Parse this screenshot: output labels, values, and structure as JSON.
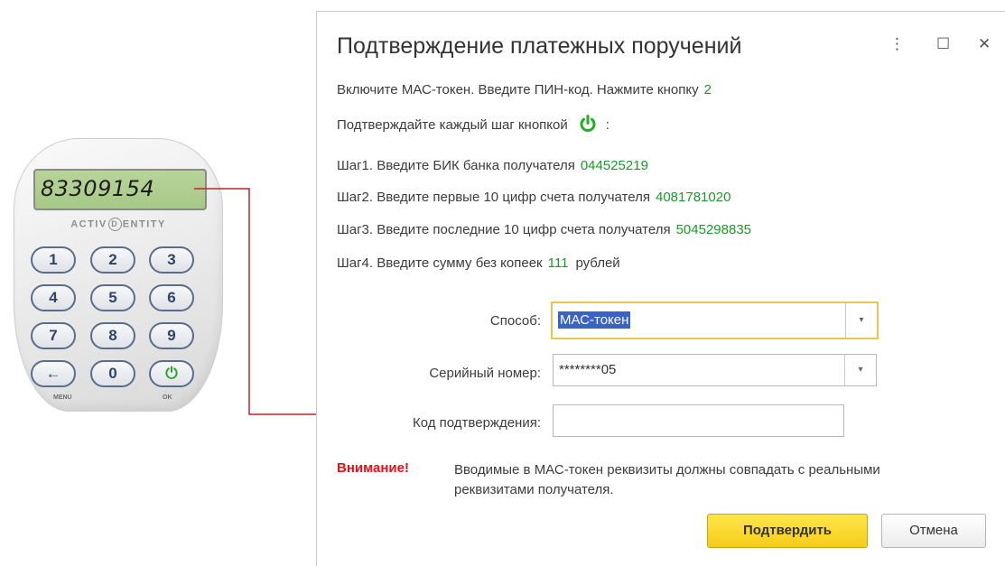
{
  "token": {
    "display": "83309154",
    "brand_left": "ACTIV",
    "brand_mid": "D",
    "brand_right": "ENTITY",
    "keys": [
      "1",
      "2",
      "3",
      "4",
      "5",
      "6",
      "7",
      "8",
      "9",
      "←",
      "0",
      "⏻"
    ],
    "menu_label": "MENU",
    "ok_label": "OK"
  },
  "dialog": {
    "title": "Подтверждение платежных поручений",
    "more_icon": "⋮",
    "maximize_icon": "☐",
    "close_icon": "✕",
    "instruction1": "Включите МАС-токен. Введите ПИН-код. Нажмите кнопку",
    "instruction1_value": "2",
    "instruction2": "Подтверждайте каждый шаг кнопкой",
    "instruction2_suffix": ":",
    "power_color": "#22b022",
    "steps": [
      {
        "label": "Шаг1. Введите БИК банка получателя",
        "value": "044525219",
        "suffix": ""
      },
      {
        "label": "Шаг2. Введите первые 10 цифр счета получателя",
        "value": "4081781020",
        "suffix": ""
      },
      {
        "label": "Шаг3. Введите последние 10 цифр счета получателя",
        "value": "5045298835",
        "suffix": ""
      },
      {
        "label": "Шаг4. Введите сумму без копеек",
        "value": "111",
        "suffix": "рублей"
      }
    ],
    "method_label": "Способ:",
    "method_value": "МАС-токен",
    "serial_label": "Серийный номер:",
    "serial_value": "********05",
    "code_label": "Код подтверждения:",
    "code_value": "",
    "warning_title": "Внимание!",
    "warning_text": "Вводимые в МАС-токен реквизиты должны совпадать с реальными реквизитами получателя.",
    "confirm_button": "Подтвердить",
    "cancel_button": "Отмена",
    "dropdown_icon": "▾"
  },
  "colors": {
    "value_green": "#1a9a2a",
    "warning_red": "#e0131b",
    "focus_yellow": "#f2c14f",
    "primary_yellow": "#f6cd16"
  }
}
